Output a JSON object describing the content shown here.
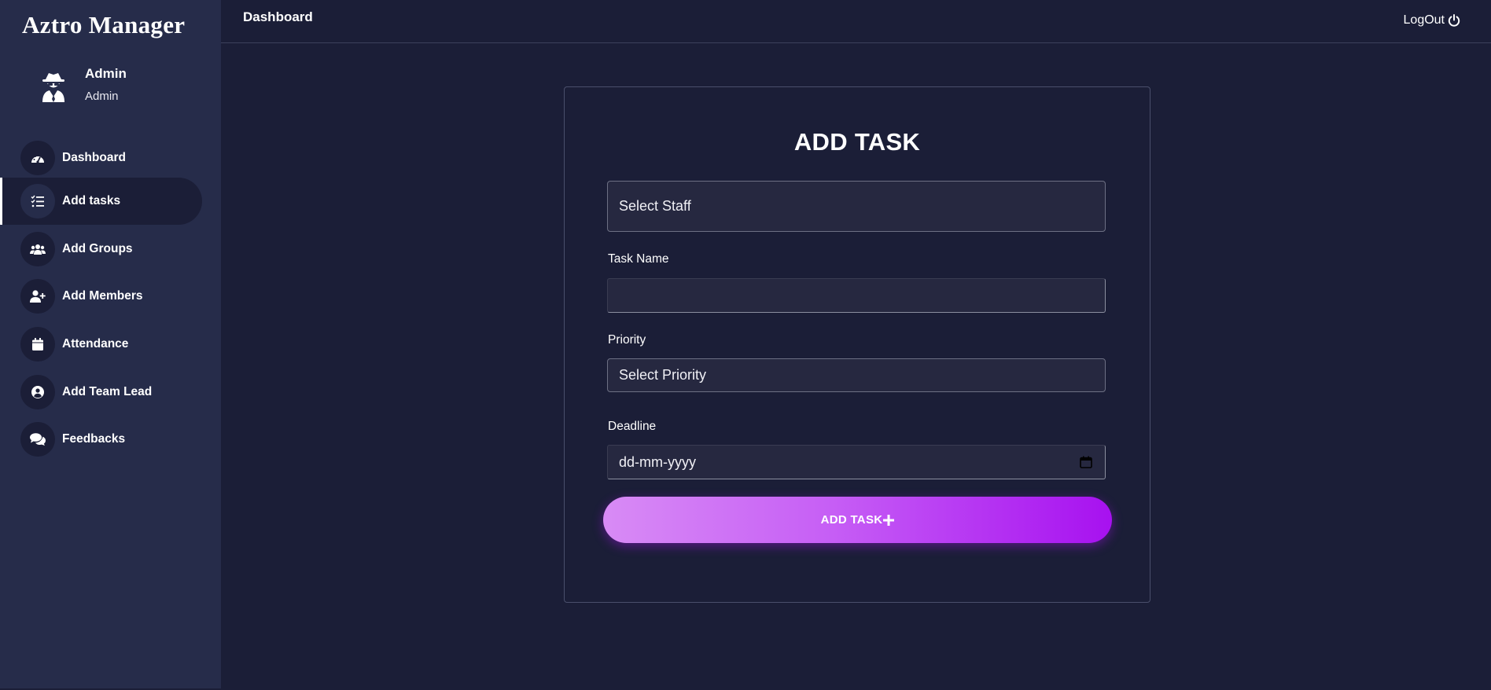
{
  "app": {
    "brand": "Aztro Manager"
  },
  "profile": {
    "name": "Admin",
    "role": "Admin",
    "avatar_icon": "user-secret-icon"
  },
  "sidebar": {
    "items": [
      {
        "label": "Dashboard",
        "icon": "speedometer-icon",
        "active": false
      },
      {
        "label": "Add tasks",
        "icon": "task-list-icon",
        "active": true
      },
      {
        "label": "Add Groups",
        "icon": "users-icon",
        "active": false
      },
      {
        "label": "Add Members",
        "icon": "user-plus-icon",
        "active": false
      },
      {
        "label": "Attendance",
        "icon": "calendar-icon",
        "active": false
      },
      {
        "label": "Add Team Lead",
        "icon": "user-circle-icon",
        "active": false
      },
      {
        "label": "Feedbacks",
        "icon": "comments-icon",
        "active": false
      }
    ]
  },
  "header": {
    "title": "Dashboard",
    "logout_label": "LogOut",
    "logout_icon": "power-icon"
  },
  "form": {
    "title": "ADD TASK",
    "staff_select": {
      "value": "Select Staff"
    },
    "task_name": {
      "label": "Task Name",
      "value": "",
      "placeholder": ""
    },
    "priority": {
      "label": "Priority",
      "value": "Select Priority"
    },
    "deadline": {
      "label": "Deadline",
      "value": "dd-mm-yyyy"
    },
    "submit_label": "ADD TASK",
    "submit_icon": "plus-icon"
  },
  "colors": {
    "background": "#1b1e37",
    "sidebar": "#262c4a",
    "button_gradient_start": "#d88bf5",
    "button_gradient_end": "#a711f0"
  }
}
